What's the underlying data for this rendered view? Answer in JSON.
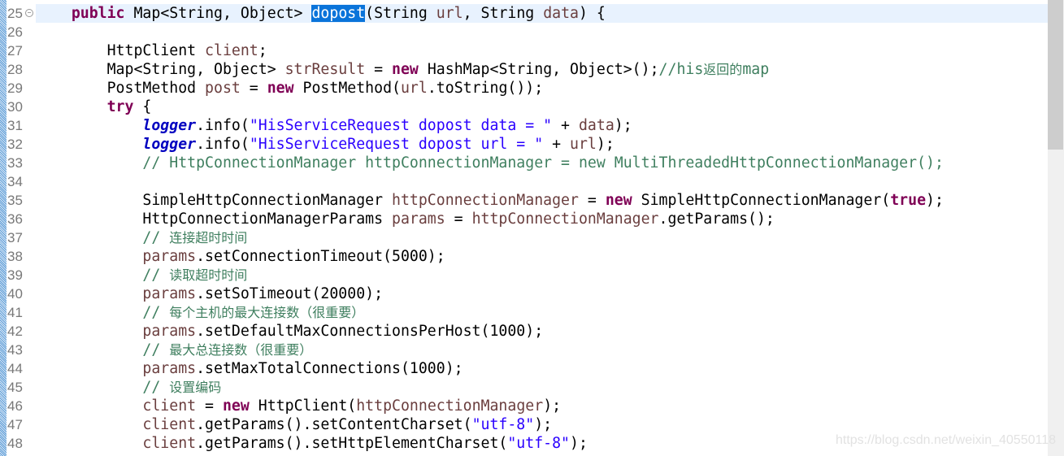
{
  "editor": {
    "current_line": 25,
    "selected_word": "dopost",
    "lines": [
      {
        "n": "25",
        "fold": true,
        "tokens": [
          [
            "    ",
            ""
          ],
          [
            "public",
            "kw"
          ],
          [
            " Map<String, Object> ",
            ""
          ],
          [
            "dopost",
            "sel"
          ],
          [
            "(String ",
            ""
          ],
          [
            "url",
            "var"
          ],
          [
            ", String ",
            ""
          ],
          [
            "data",
            "var"
          ],
          [
            ") {",
            ""
          ]
        ]
      },
      {
        "n": "26",
        "tokens": []
      },
      {
        "n": "27",
        "tokens": [
          [
            "        HttpClient ",
            ""
          ],
          [
            "client",
            "var"
          ],
          [
            ";",
            ""
          ]
        ]
      },
      {
        "n": "28",
        "tokens": [
          [
            "        Map<String, Object> ",
            ""
          ],
          [
            "strResult",
            "var"
          ],
          [
            " = ",
            ""
          ],
          [
            "new",
            "kw"
          ],
          [
            " HashMap<String, Object>();",
            ""
          ],
          [
            "//his",
            "cm"
          ],
          [
            "返回的",
            "cm cjk"
          ],
          [
            "map",
            "cm"
          ]
        ]
      },
      {
        "n": "29",
        "tokens": [
          [
            "        PostMethod ",
            ""
          ],
          [
            "post",
            "var"
          ],
          [
            " = ",
            ""
          ],
          [
            "new",
            "kw"
          ],
          [
            " PostMethod(",
            ""
          ],
          [
            "url",
            "var"
          ],
          [
            ".toString());",
            ""
          ]
        ]
      },
      {
        "n": "30",
        "tokens": [
          [
            "        ",
            ""
          ],
          [
            "try",
            "kw"
          ],
          [
            " {",
            ""
          ]
        ]
      },
      {
        "n": "31",
        "tokens": [
          [
            "            ",
            ""
          ],
          [
            "logger",
            "st"
          ],
          [
            ".info(",
            ""
          ],
          [
            "\"HisServiceRequest dopost data = \"",
            "str"
          ],
          [
            " + ",
            ""
          ],
          [
            "data",
            "var"
          ],
          [
            ");",
            ""
          ]
        ]
      },
      {
        "n": "32",
        "tokens": [
          [
            "            ",
            ""
          ],
          [
            "logger",
            "st"
          ],
          [
            ".info(",
            ""
          ],
          [
            "\"HisServiceRequest dopost url = \"",
            "str"
          ],
          [
            " + ",
            ""
          ],
          [
            "url",
            "var"
          ],
          [
            ");",
            ""
          ]
        ]
      },
      {
        "n": "33",
        "tokens": [
          [
            "            ",
            ""
          ],
          [
            "// HttpConnectionManager httpConnectionManager = new MultiThreadedHttpConnectionManager();",
            "cm"
          ]
        ]
      },
      {
        "n": "34",
        "tokens": []
      },
      {
        "n": "35",
        "tokens": [
          [
            "            SimpleHttpConnectionManager ",
            ""
          ],
          [
            "httpConnectionManager",
            "var"
          ],
          [
            " = ",
            ""
          ],
          [
            "new",
            "kw"
          ],
          [
            " SimpleHttpConnectionManager(",
            ""
          ],
          [
            "true",
            "kw"
          ],
          [
            ");",
            ""
          ]
        ]
      },
      {
        "n": "36",
        "tokens": [
          [
            "            HttpConnectionManagerParams ",
            ""
          ],
          [
            "params",
            "var"
          ],
          [
            " = ",
            ""
          ],
          [
            "httpConnectionManager",
            "var"
          ],
          [
            ".getParams();",
            ""
          ]
        ]
      },
      {
        "n": "37",
        "tokens": [
          [
            "            ",
            ""
          ],
          [
            "// ",
            "cm"
          ],
          [
            "连接超时时间",
            "cm cjk"
          ]
        ]
      },
      {
        "n": "38",
        "tokens": [
          [
            "            ",
            ""
          ],
          [
            "params",
            "var"
          ],
          [
            ".setConnectionTimeout(5000);",
            ""
          ]
        ]
      },
      {
        "n": "39",
        "tokens": [
          [
            "            ",
            ""
          ],
          [
            "// ",
            "cm"
          ],
          [
            "读取超时时间",
            "cm cjk"
          ]
        ]
      },
      {
        "n": "40",
        "tokens": [
          [
            "            ",
            ""
          ],
          [
            "params",
            "var"
          ],
          [
            ".setSoTimeout(20000);",
            ""
          ]
        ]
      },
      {
        "n": "41",
        "tokens": [
          [
            "            ",
            ""
          ],
          [
            "// ",
            "cm"
          ],
          [
            "每个主机的最大连接数（很重要）",
            "cm cjk"
          ]
        ]
      },
      {
        "n": "42",
        "tokens": [
          [
            "            ",
            ""
          ],
          [
            "params",
            "var"
          ],
          [
            ".setDefaultMaxConnectionsPerHost(1000);",
            ""
          ]
        ]
      },
      {
        "n": "43",
        "tokens": [
          [
            "            ",
            ""
          ],
          [
            "// ",
            "cm"
          ],
          [
            "最大总连接数（很重要）",
            "cm cjk"
          ]
        ]
      },
      {
        "n": "44",
        "tokens": [
          [
            "            ",
            ""
          ],
          [
            "params",
            "var"
          ],
          [
            ".setMaxTotalConnections(1000);",
            ""
          ]
        ]
      },
      {
        "n": "45",
        "tokens": [
          [
            "            ",
            ""
          ],
          [
            "// ",
            "cm"
          ],
          [
            "设置编码",
            "cm cjk"
          ]
        ]
      },
      {
        "n": "46",
        "tokens": [
          [
            "            ",
            ""
          ],
          [
            "client",
            "var"
          ],
          [
            " = ",
            ""
          ],
          [
            "new",
            "kw"
          ],
          [
            " HttpClient(",
            ""
          ],
          [
            "httpConnectionManager",
            "var"
          ],
          [
            ");",
            ""
          ]
        ]
      },
      {
        "n": "47",
        "tokens": [
          [
            "            ",
            ""
          ],
          [
            "client",
            "var"
          ],
          [
            ".getParams().setContentCharset(",
            ""
          ],
          [
            "\"utf-8\"",
            "str"
          ],
          [
            ");",
            ""
          ]
        ]
      },
      {
        "n": "48",
        "tokens": [
          [
            "            ",
            ""
          ],
          [
            "client",
            "var"
          ],
          [
            ".getParams().setHttpElementCharset(",
            ""
          ],
          [
            "\"utf-8\"",
            "str"
          ],
          [
            ");",
            ""
          ]
        ]
      }
    ]
  },
  "colors": {
    "keyword": "#7f0055",
    "variable": "#6a3e3e",
    "string": "#2a00ff",
    "comment": "#3f7f5f",
    "static_field": "#0000c0",
    "selection": "#0a74da",
    "current_line": "#e8f2fe"
  },
  "watermark": "https://blog.csdn.net/weixin_40550118"
}
